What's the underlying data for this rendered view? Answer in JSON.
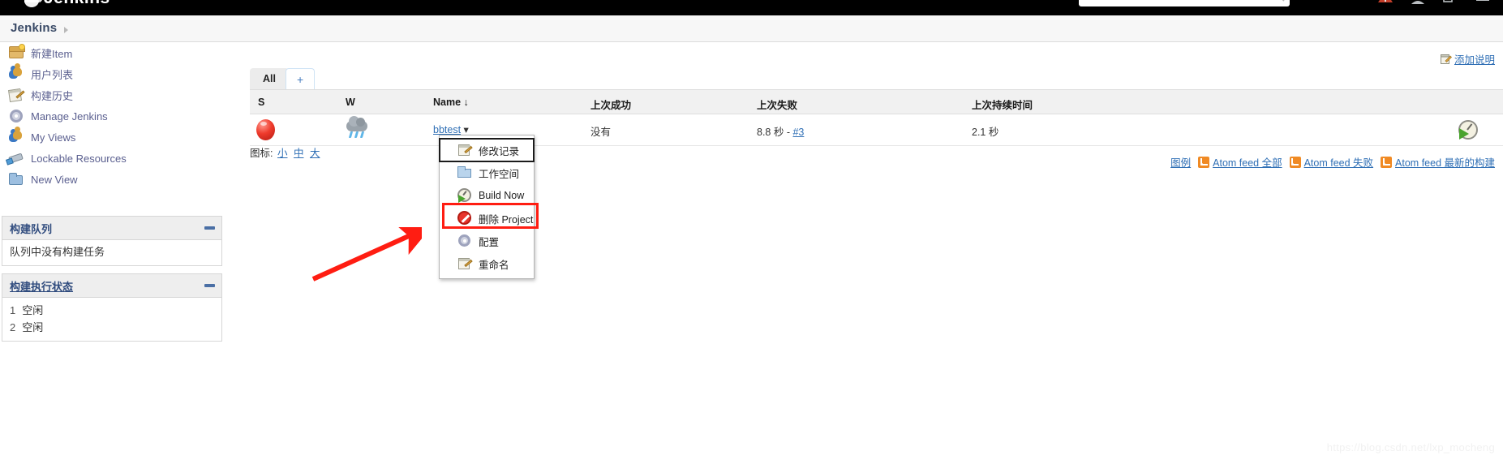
{
  "topbar": {
    "logo_text": "Jenkins",
    "search_placeholder": "",
    "search_value": "",
    "icons": [
      "search-icon",
      "alert-icon",
      "user-icon",
      "logout-icon",
      "menu-icon"
    ]
  },
  "breadcrumb": {
    "home_label": "Jenkins",
    "separator": "▸"
  },
  "sidebar": {
    "items": [
      {
        "label": "新建Item",
        "icon": "new-item-icon"
      },
      {
        "label": "用户列表",
        "icon": "people-icon"
      },
      {
        "label": "构建历史",
        "icon": "notepad-pencil-icon"
      },
      {
        "label": "Manage Jenkins",
        "icon": "gear-icon"
      },
      {
        "label": "My Views",
        "icon": "people-icon"
      },
      {
        "label": "Lockable Resources",
        "icon": "usb-key-icon"
      },
      {
        "label": "New View",
        "icon": "folder-icon"
      }
    ],
    "build_queue": {
      "title": "构建队列",
      "empty_text": "队列中没有构建任务"
    },
    "build_executor_status": {
      "title": "构建执行状态",
      "executors": [
        {
          "num": "1",
          "state": "空闲"
        },
        {
          "num": "2",
          "state": "空闲"
        }
      ]
    }
  },
  "main": {
    "add_description": "添加说明",
    "tabs": [
      {
        "label": "All",
        "active": true
      },
      {
        "label": "+",
        "active": false
      }
    ],
    "table": {
      "columns": [
        {
          "key": "s",
          "label": "S"
        },
        {
          "key": "w",
          "label": "W"
        },
        {
          "key": "name",
          "label": "Name ↓"
        },
        {
          "key": "last_success",
          "label": "上次成功"
        },
        {
          "key": "last_failure",
          "label": "上次失败"
        },
        {
          "key": "last_duration",
          "label": "上次持续时间"
        }
      ],
      "rows": [
        {
          "status_icon": "red-ball-icon",
          "weather_icon": "storm-cloud-icon",
          "name": "bbtest",
          "name_caret": "▾",
          "last_success": "没有",
          "last_failure_time": "8.8 秒 - ",
          "last_failure_build": "#3",
          "last_duration": "2.1 秒",
          "action_icon": "schedule-build-icon"
        }
      ]
    },
    "legend": {
      "prefix": "图标:",
      "sizes": [
        "小",
        "中",
        "大"
      ]
    },
    "feeds": [
      {
        "label": "图例",
        "has_icon": false
      },
      {
        "label": "Atom feed 全部",
        "has_icon": true
      },
      {
        "label": "Atom feed 失败",
        "has_icon": true
      },
      {
        "label": "Atom feed 最新的构建",
        "has_icon": true
      }
    ]
  },
  "context_menu": {
    "items": [
      {
        "label": "修改记录",
        "icon": "changes-icon",
        "focused": true,
        "highlighted": false
      },
      {
        "label": "工作空间",
        "icon": "workspace-folder-icon",
        "focused": false,
        "highlighted": false
      },
      {
        "label": "Build Now",
        "icon": "build-now-icon",
        "focused": false,
        "highlighted": false
      },
      {
        "label": "删除 Project",
        "icon": "delete-icon",
        "focused": false,
        "highlighted": true
      },
      {
        "label": "配置",
        "icon": "configure-gear-icon",
        "focused": false,
        "highlighted": false
      },
      {
        "label": "重命名",
        "icon": "rename-icon",
        "focused": false,
        "highlighted": false
      }
    ]
  },
  "annotation": {
    "arrow_color": "#ff1d12",
    "highlight_color": "#ff1d12"
  },
  "watermark": "https://blog.csdn.net/lxp_mocheng"
}
